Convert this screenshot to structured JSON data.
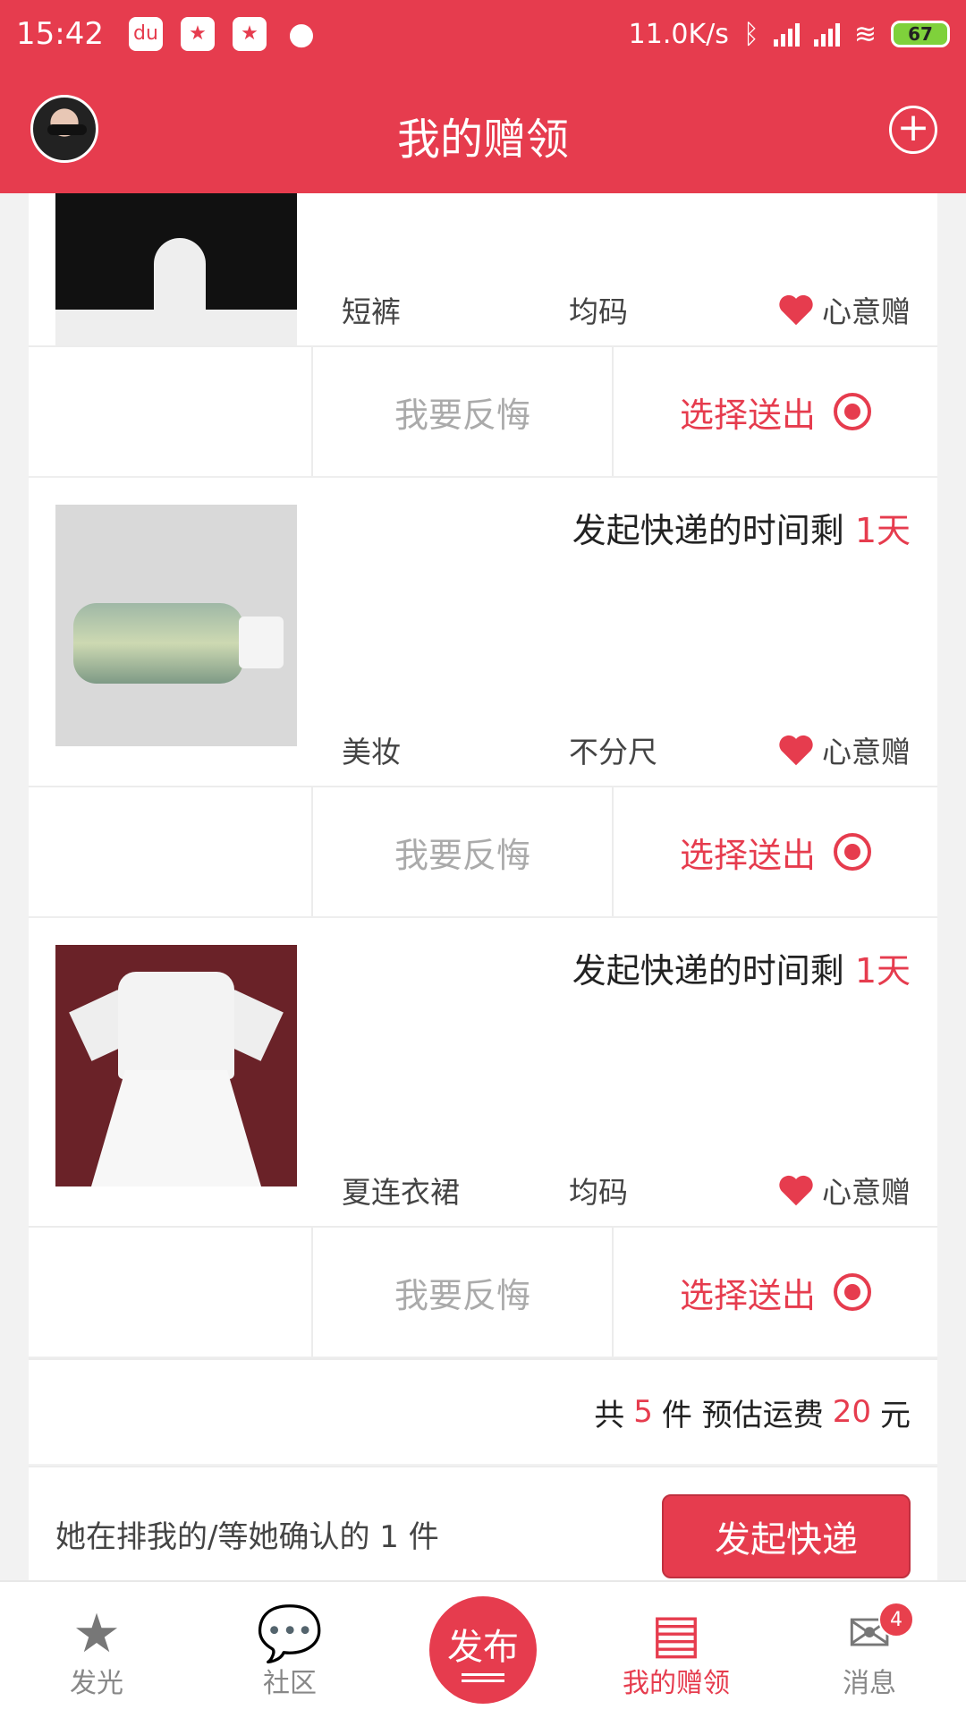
{
  "status_bar": {
    "time": "15:42",
    "network_speed": "11.0K/s",
    "battery": "67",
    "icons": [
      "baidu-icon",
      "star-app-icon",
      "star-app-icon",
      "moon-icon",
      "bluetooth-icon",
      "signal-icon",
      "signal-icon",
      "wifi-icon",
      "battery-icon"
    ]
  },
  "header": {
    "title": "我的赠领"
  },
  "items": [
    {
      "category": "短裤",
      "size": "均码",
      "gift_label": "心意赠",
      "regret_label": "我要反悔",
      "select_label": "选择送出"
    },
    {
      "countdown_prefix": "发起快递的时间剩 ",
      "countdown_value": "1天",
      "category": "美妆",
      "size": "不分尺",
      "gift_label": "心意赠",
      "regret_label": "我要反悔",
      "select_label": "选择送出"
    },
    {
      "countdown_prefix": "发起快递的时间剩 ",
      "countdown_value": "1天",
      "category": "夏连衣裙",
      "size": "均码",
      "gift_label": "心意赠",
      "regret_label": "我要反悔",
      "select_label": "选择送出"
    }
  ],
  "summary": {
    "total_prefix": "共",
    "total_count": "5",
    "total_middle": "件 预估运费",
    "shipping_fee": "20",
    "total_suffix": "元",
    "queue_text": "她在排我的/等她确认的 1 件",
    "send_button": "发起快递"
  },
  "bottom_nav": {
    "items": [
      {
        "label": "发光",
        "icon": "star-icon"
      },
      {
        "label": "社区",
        "icon": "chat-icon"
      },
      {
        "label": "发布",
        "icon": "publish-icon"
      },
      {
        "label": "我的赠领",
        "icon": "gift-box-icon"
      },
      {
        "label": "消息",
        "icon": "mail-icon",
        "badge": "4"
      }
    ],
    "active": "我的赠领"
  },
  "colors": {
    "accent": "#e63c4e",
    "muted_text": "#aaaaaa"
  }
}
